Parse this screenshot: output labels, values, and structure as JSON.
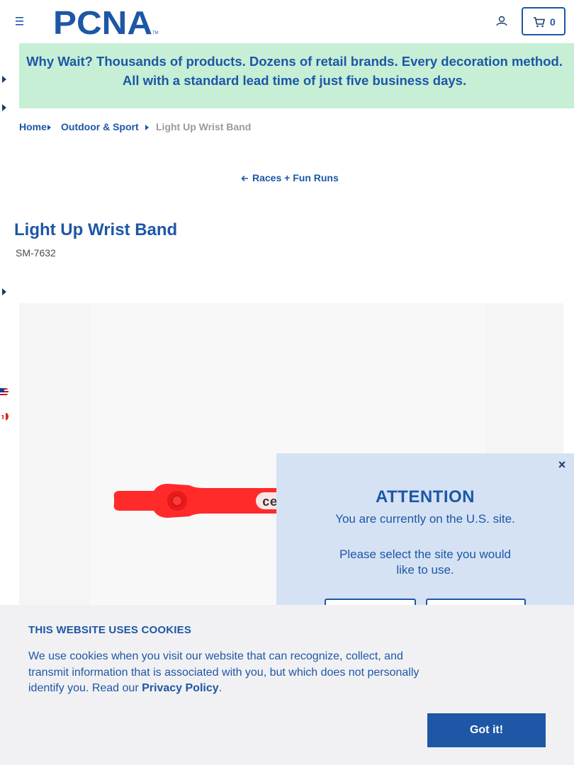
{
  "header": {
    "logo_text": "PCNA",
    "cart_count": "0"
  },
  "promo": {
    "text": "Why Wait? Thousands of products. Dozens of retail brands. Every decoration method. All with a standard lead time of just five business days."
  },
  "breadcrumb": {
    "items": [
      "Home",
      "Outdoor & Sport",
      "Light Up Wrist Band"
    ]
  },
  "back_link": "Races + Fun Runs",
  "product": {
    "title": "Light Up Wrist Band",
    "sku": "SM-7632",
    "imprint_text": "cere",
    "band_color": "#ff2a2a"
  },
  "site_popup": {
    "close_label": "×",
    "title": "ATTENTION",
    "message": "You are currently on the U.S. site.",
    "prompt": "Please select the site you would like to use."
  },
  "cookie_banner": {
    "heading": "THIS WEBSITE USES COOKIES",
    "body": "We use cookies when you visit our website that can recognize, collect, and transmit information that is associated with you, but which does not personally identify you. Read our",
    "link": "Privacy Policy",
    "period": ".",
    "button": "Got it!"
  },
  "colors": {
    "brand_blue": "#1d57a6",
    "promo_green": "#c6efd6",
    "popup_blue": "#d5e2f4"
  }
}
